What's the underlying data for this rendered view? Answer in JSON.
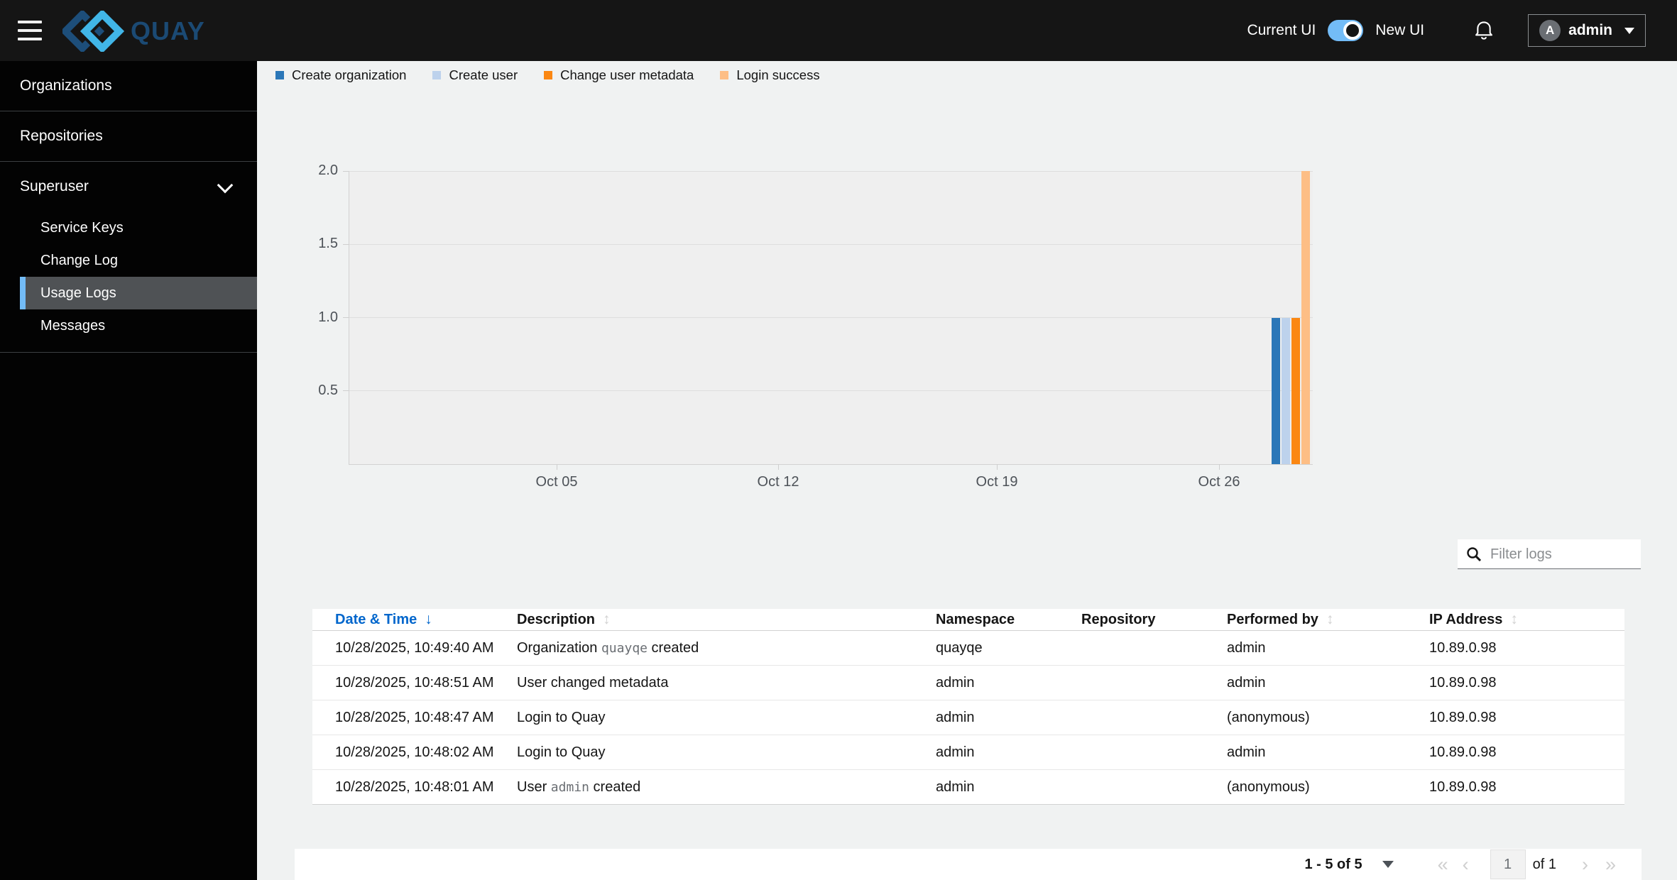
{
  "colors": {
    "masthead_bg": "#151515",
    "sidebar_selected_bg": "#4f5255",
    "accent_blue": "#73bcf7",
    "link_blue": "#0066cc",
    "content_bg": "#f0f2f2"
  },
  "masthead": {
    "brand": "QUAY",
    "ui_toggle": {
      "left_label": "Current UI",
      "right_label": "New UI",
      "on": true
    },
    "user": {
      "name": "admin",
      "initial": "A"
    }
  },
  "sidebar": {
    "items": [
      {
        "label": "Organizations"
      },
      {
        "label": "Repositories"
      },
      {
        "label": "Superuser",
        "expanded": true,
        "children": [
          {
            "label": "Service Keys"
          },
          {
            "label": "Change Log"
          },
          {
            "label": "Usage Logs",
            "selected": true
          },
          {
            "label": "Messages"
          }
        ]
      }
    ]
  },
  "chart_data": {
    "type": "bar",
    "title": "",
    "xlabel": "",
    "ylabel": "",
    "x_ticks": [
      "Oct 05",
      "Oct 12",
      "Oct 19",
      "Oct 26"
    ],
    "y_ticks": [
      "0.5",
      "1.0",
      "1.5",
      "2.0"
    ],
    "ylim": [
      0,
      2
    ],
    "grid": "horizontal",
    "legend_position": "top-left",
    "series": [
      {
        "name": "Create organization",
        "color": "#2b77b8",
        "x": "Oct 28",
        "value": 1
      },
      {
        "name": "Create user",
        "color": "#bdd2ec",
        "x": "Oct 28",
        "value": 1
      },
      {
        "name": "Change user metadata",
        "color": "#fb8712",
        "x": "Oct 28",
        "value": 1
      },
      {
        "name": "Login success",
        "color": "#fdbe85",
        "x": "Oct 28",
        "value": 2
      }
    ]
  },
  "filter": {
    "placeholder": "Filter logs"
  },
  "logs_table": {
    "columns": [
      {
        "label": "Date & Time",
        "active": true,
        "sort": "desc"
      },
      {
        "label": "Description",
        "sortable": true
      },
      {
        "label": "Namespace"
      },
      {
        "label": "Repository"
      },
      {
        "label": "Performed by",
        "sortable": true
      },
      {
        "label": "IP Address",
        "sortable": true
      }
    ],
    "rows": [
      {
        "datetime": "10/28/2025, 10:49:40 AM",
        "description": [
          {
            "text": "Organization "
          },
          {
            "text": "quayqe",
            "mono": true
          },
          {
            "text": " created"
          }
        ],
        "namespace": "quayqe",
        "repository": "",
        "performed_by": "admin",
        "ip": "10.89.0.98"
      },
      {
        "datetime": "10/28/2025, 10:48:51 AM",
        "description": [
          {
            "text": "User changed metadata"
          }
        ],
        "namespace": "admin",
        "repository": "",
        "performed_by": "admin",
        "ip": "10.89.0.98"
      },
      {
        "datetime": "10/28/2025, 10:48:47 AM",
        "description": [
          {
            "text": "Login to Quay"
          }
        ],
        "namespace": "admin",
        "repository": "",
        "performed_by": "(anonymous)",
        "ip": "10.89.0.98"
      },
      {
        "datetime": "10/28/2025, 10:48:02 AM",
        "description": [
          {
            "text": "Login to Quay"
          }
        ],
        "namespace": "admin",
        "repository": "",
        "performed_by": "admin",
        "ip": "10.89.0.98"
      },
      {
        "datetime": "10/28/2025, 10:48:01 AM",
        "description": [
          {
            "text": "User "
          },
          {
            "text": "admin",
            "mono": true
          },
          {
            "text": " created"
          }
        ],
        "namespace": "admin",
        "repository": "",
        "performed_by": "(anonymous)",
        "ip": "10.89.0.98"
      }
    ]
  },
  "pagination": {
    "summary": "1 - 5 of 5",
    "page": "1",
    "of_pages": "of 1",
    "first_icon": "«",
    "prev_icon": "‹",
    "next_icon": "›",
    "last_icon": "»"
  }
}
